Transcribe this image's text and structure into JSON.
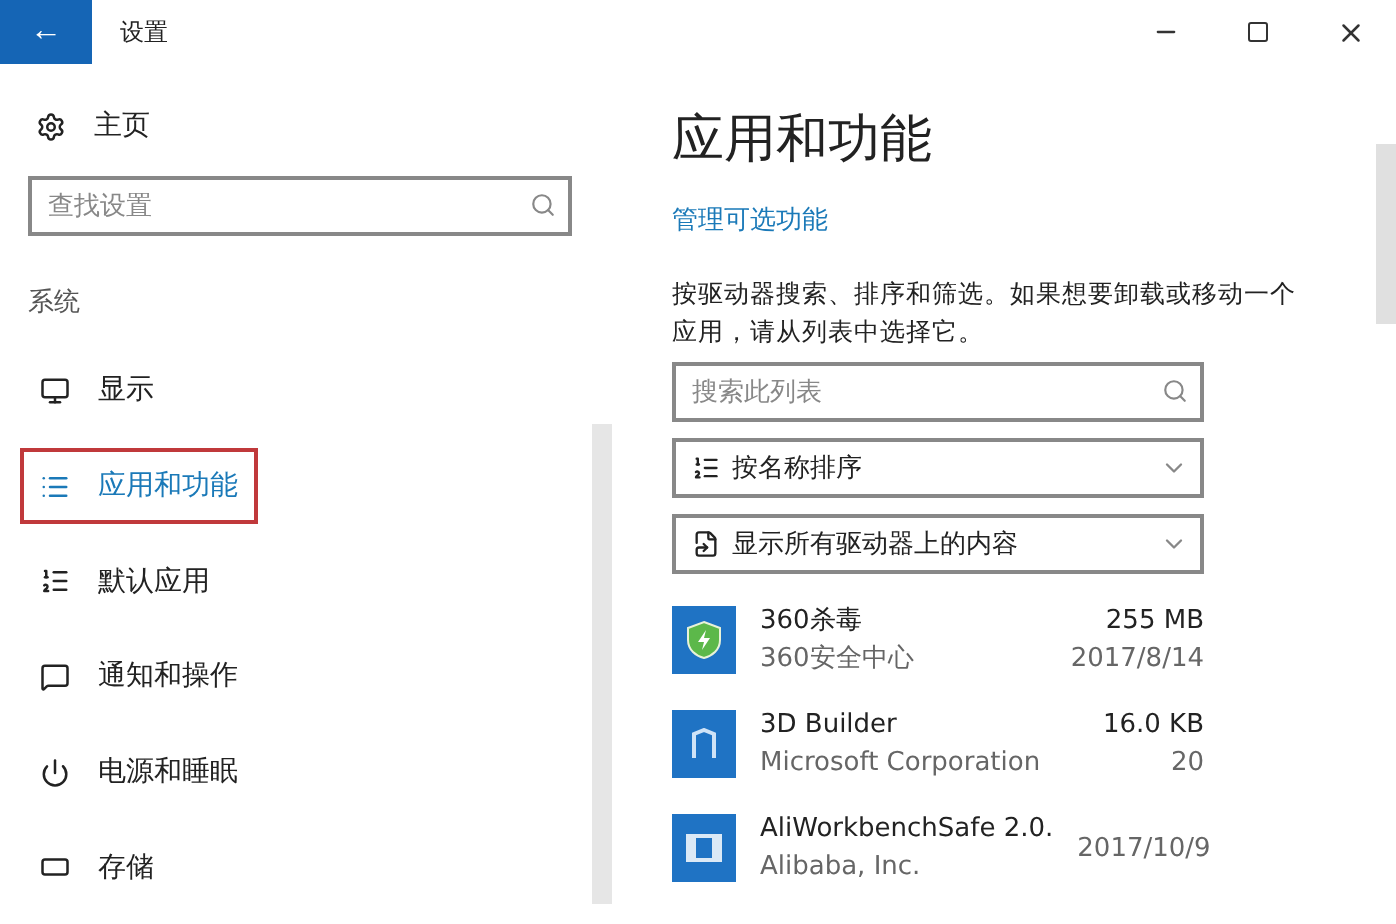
{
  "window": {
    "title": "设置",
    "back": "←"
  },
  "sidebar": {
    "home": "主页",
    "search": {
      "placeholder": "查找设置"
    },
    "section": "系统",
    "items": [
      {
        "label": "显示",
        "selected": false
      },
      {
        "label": "应用和功能",
        "selected": true
      },
      {
        "label": "默认应用",
        "selected": false
      },
      {
        "label": "通知和操作",
        "selected": false
      },
      {
        "label": "电源和睡眠",
        "selected": false
      },
      {
        "label": "存储",
        "selected": false
      }
    ]
  },
  "main": {
    "title": "应用和功能",
    "link": "管理可选功能",
    "description": "按驱动器搜索、排序和筛选。如果想要卸载或移动一个应用，请从列表中选择它。",
    "search": {
      "placeholder": "搜索此列表"
    },
    "sort": {
      "value": "按名称排序"
    },
    "filter": {
      "value": "显示所有驱动器上的内容"
    },
    "apps": [
      {
        "name": "360杀毒",
        "publisher": "360安全中心",
        "size": "255 MB",
        "date": "2017/8/14"
      },
      {
        "name": "3D Builder",
        "publisher": "Microsoft Corporation",
        "size": "16.0 KB",
        "date": "20"
      },
      {
        "name": "AliWorkbenchSafe 2.0.",
        "publisher": "Alibaba, Inc.",
        "date": "2017/10/9"
      }
    ]
  }
}
